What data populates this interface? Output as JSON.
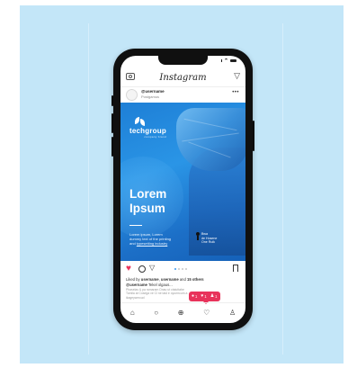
{
  "app": {
    "title": "Instagram"
  },
  "profile": {
    "username": "@username",
    "location": "Postgamus"
  },
  "post": {
    "brand_name": "techgroup",
    "brand_tagline": "company brand",
    "headline_line1": "Lorem",
    "headline_line2": "Ipsum",
    "desc_line1": "Lorem ipsum, Lorem",
    "desc_line2": "dummy text of the printing",
    "desc_line3_a": "and ",
    "desc_line3_b": "typesetting industry",
    "contact_line1": "Bwa",
    "contact_line2": "de Hosene",
    "contact_line3": "One Ruik"
  },
  "engagement": {
    "liked_prefix": "Liked by ",
    "liked_user1": "username",
    "liked_sep": ", ",
    "liked_user2": "username",
    "liked_and": " and ",
    "liked_others": "15 others",
    "caption_user": "@username",
    "caption_text": " Tekel olgaus...",
    "caption2": "Phaselas & pa ramaram Dnau ut ctaiuttabe Tomila at Cosega ve Cl ne taid e oyumrcum a ikageywmcud",
    "notif_comments": "1",
    "notif_likes": "1",
    "notif_follows": "1"
  },
  "colors": {
    "accent": "#e8335b",
    "post_blue": "#2a95e6",
    "background": "#c3e6f8"
  },
  "icons": [
    "camera-icon",
    "send-icon",
    "more-icon",
    "heart-icon",
    "comment-icon",
    "share-icon",
    "bookmark-icon",
    "home-icon",
    "search-icon",
    "add-icon",
    "activity-icon",
    "profile-icon"
  ]
}
